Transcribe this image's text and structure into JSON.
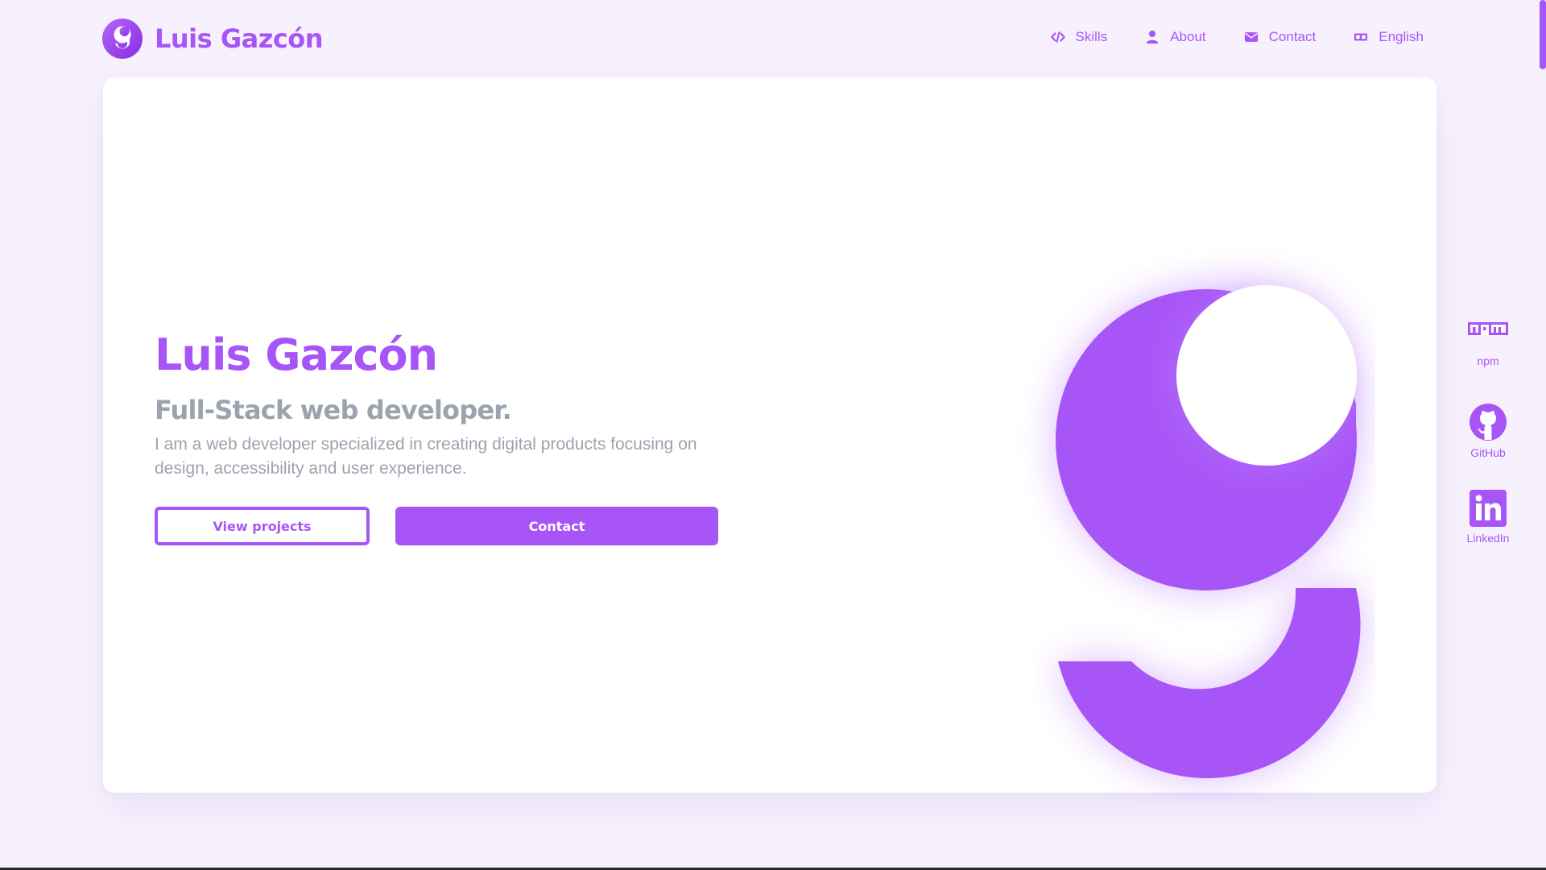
{
  "header": {
    "brand": {
      "name": "Luis Gazcón",
      "logo_icon": "g-logo-icon"
    },
    "nav": [
      {
        "label": "Skills",
        "icon": "code-icon"
      },
      {
        "label": "About",
        "icon": "user-icon"
      },
      {
        "label": "Contact",
        "icon": "envelope-icon"
      },
      {
        "label": "English",
        "icon": "language-icon"
      }
    ]
  },
  "hero": {
    "title": "Luis Gazcón",
    "subtitle": "Full-Stack web developer.",
    "description": "I am a web developer specialized in creating digital products focusing on design, accessibility and user experience.",
    "buttons": {
      "primary_outline": "View projects",
      "primary_fill": "Contact"
    },
    "illustration_icon": "g-logo-large-icon"
  },
  "social": [
    {
      "label": "npm",
      "icon": "npm-icon"
    },
    {
      "label": "GitHub",
      "icon": "github-icon"
    },
    {
      "label": "LinkedIn",
      "icon": "linkedin-icon"
    }
  ],
  "colors": {
    "accent": "#a855f7",
    "muted_text": "#9ca3af",
    "background": "#f7f1fe",
    "card": "#ffffff"
  }
}
